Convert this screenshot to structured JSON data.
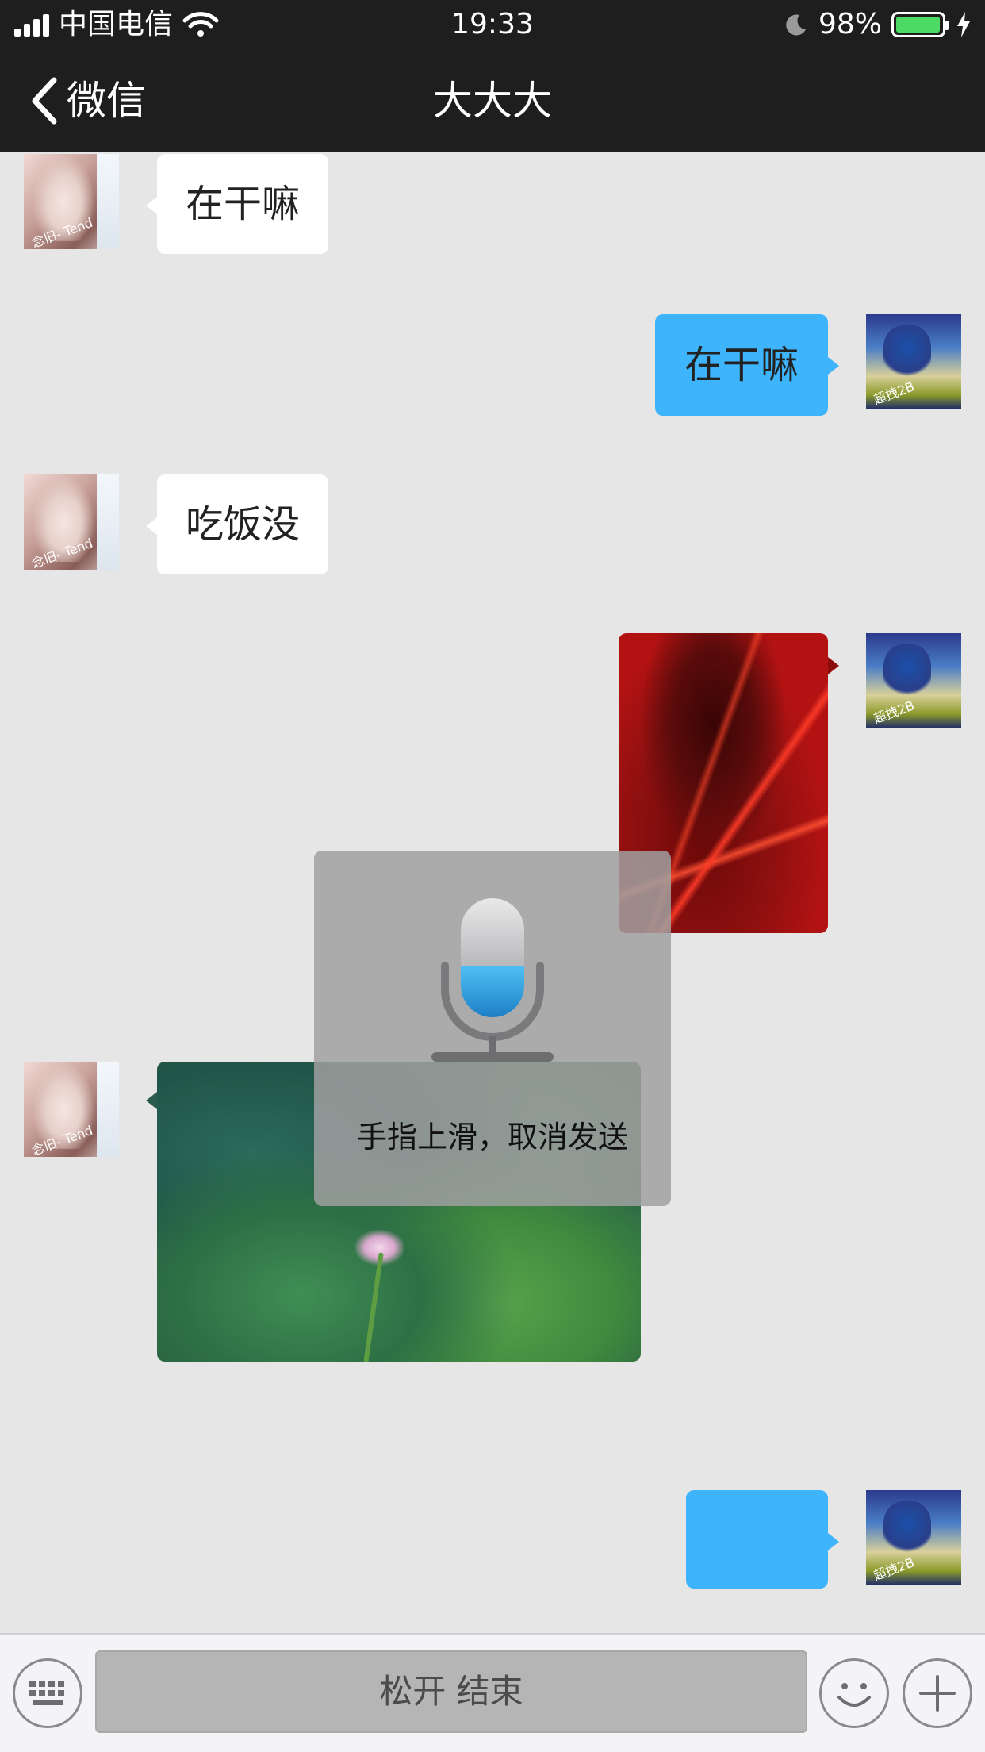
{
  "status_bar": {
    "carrier": "中国电信",
    "time": "19:33",
    "battery_percent": "98%",
    "battery_level": 0.98,
    "icons": [
      "signal-icon",
      "wifi-icon",
      "moon-icon",
      "battery-icon",
      "charging-bolt-icon"
    ]
  },
  "nav": {
    "back_label": "微信",
    "title": "大大大"
  },
  "messages": [
    {
      "side": "left",
      "type": "text",
      "text": "在干嘛"
    },
    {
      "side": "right",
      "type": "text",
      "text": "在干嘛"
    },
    {
      "side": "left",
      "type": "text",
      "text": "吃饭没"
    },
    {
      "side": "right",
      "type": "image"
    },
    {
      "side": "left",
      "type": "image"
    },
    {
      "side": "right",
      "type": "text",
      "text": ""
    }
  ],
  "avatars": {
    "girl_tag": "念旧-   Tend",
    "boy_tag": "超拽2B"
  },
  "recording": {
    "hint": "手指上滑，取消发送"
  },
  "toolbar": {
    "hold_label": "松开 结束"
  },
  "colors": {
    "nav_bg": "#1e1e1e",
    "chat_bg": "#e6e6e6",
    "sent_bubble": "#3db4fb",
    "received_bubble": "#ffffff",
    "battery_fill": "#4cd964"
  }
}
